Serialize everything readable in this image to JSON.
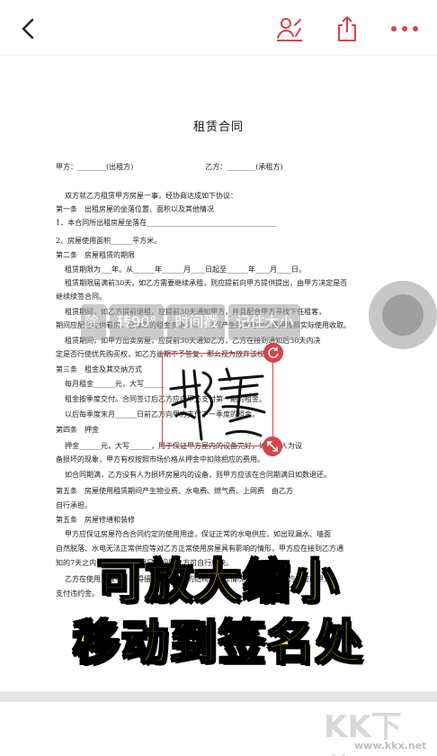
{
  "header": {
    "back_icon": "chevron-left-icon",
    "sign_icon": "signature-icon",
    "share_icon": "share-icon",
    "more_icon": "more-dots-icon",
    "accent": "#d8434a"
  },
  "document": {
    "title": "租赁合同",
    "lines": [
      "甲方：________(出租方)　　　　　　　　　　乙方：________(承租方)",
      "双方就乙方租赁甲方房屋一事，经协商达成如下协议：",
      "第一条　出租房屋的坐落位置、面积以及其他情况",
      "1、本合同所出租房屋坐落在____________________________________",
      "2、房屋使用面积______平方米。",
      "第二条　房屋租赁的期限",
      "租赁期限为___年。从______年______月____日起至______年____月____日。",
      "租赁期限届满前30天，如乙方需要继续承租，则应提前向甲方提供提出，由甲方决定是否",
      "继续续签合同。",
      "租赁期间，如乙方提前退租，应提前30天通知甲方，并且配合甲方寻找下任租客，",
      "期间应配合提供看房，已收取的租金多退少补，期间产生的水电物业费用按照实际使用收取。",
      "租赁期间，如甲方出卖房屋，应提前30天通知乙方，乙方在接到通知后30天内决",
      "定是否行使优先购买权，如乙方逾期不予答复，那么视为放弃该权利。",
      "第三条　租金及其交纳方式",
      "每月租金______元，大写______",
      "租金按季度交付。合同签订后乙方应向甲方支付第一期的租金。",
      "以后每季度末月______日前乙方向甲方支付下一季度的租金。",
      "第四条　押金",
      "押金______元，大写______，用于保证甲方屋内的设备完好，如出现人为设",
      "备损坏的现象，甲方有权按照市场价格从押金中扣除相应的费用。",
      "如合同期满，乙方没有人为损坏房屋内的设备，则甲方应该在合同期满日如数退还。",
      "第五条　房屋使用租赁期间产生物业费、水电费、燃气费、上网费　由乙方",
      "自行承担。",
      "第五条　房屋修缮和装修",
      "甲方应保证房屋符合合同约定的使用用途，保证正常的水电供应，如出现漏水、墙面",
      "自然脱落、水电无法正常供应等对乙方正常使用房屋具有影响的情形，甲方应在接到乙方通",
      "知的7天之内予以解决。如果是小问题乙方可自行解决。",
      "乙方在使用过程中，不得擅自改变房屋的结构和装修情况，否则视为违约，应向甲方",
      "支付违约金。"
    ]
  },
  "toolbar": {
    "items": [
      "除",
      "转90°",
      "时间戳",
      "记住大小"
    ]
  },
  "signature": {
    "text": "郝露",
    "rotate_icon": "rotate-icon",
    "scale_icon": "resize-icon"
  },
  "caption": {
    "line1": "可放大缩小",
    "line2": "移动到签名处"
  },
  "watermark": {
    "logo": "KK下载",
    "url": "www.kkx.net"
  }
}
